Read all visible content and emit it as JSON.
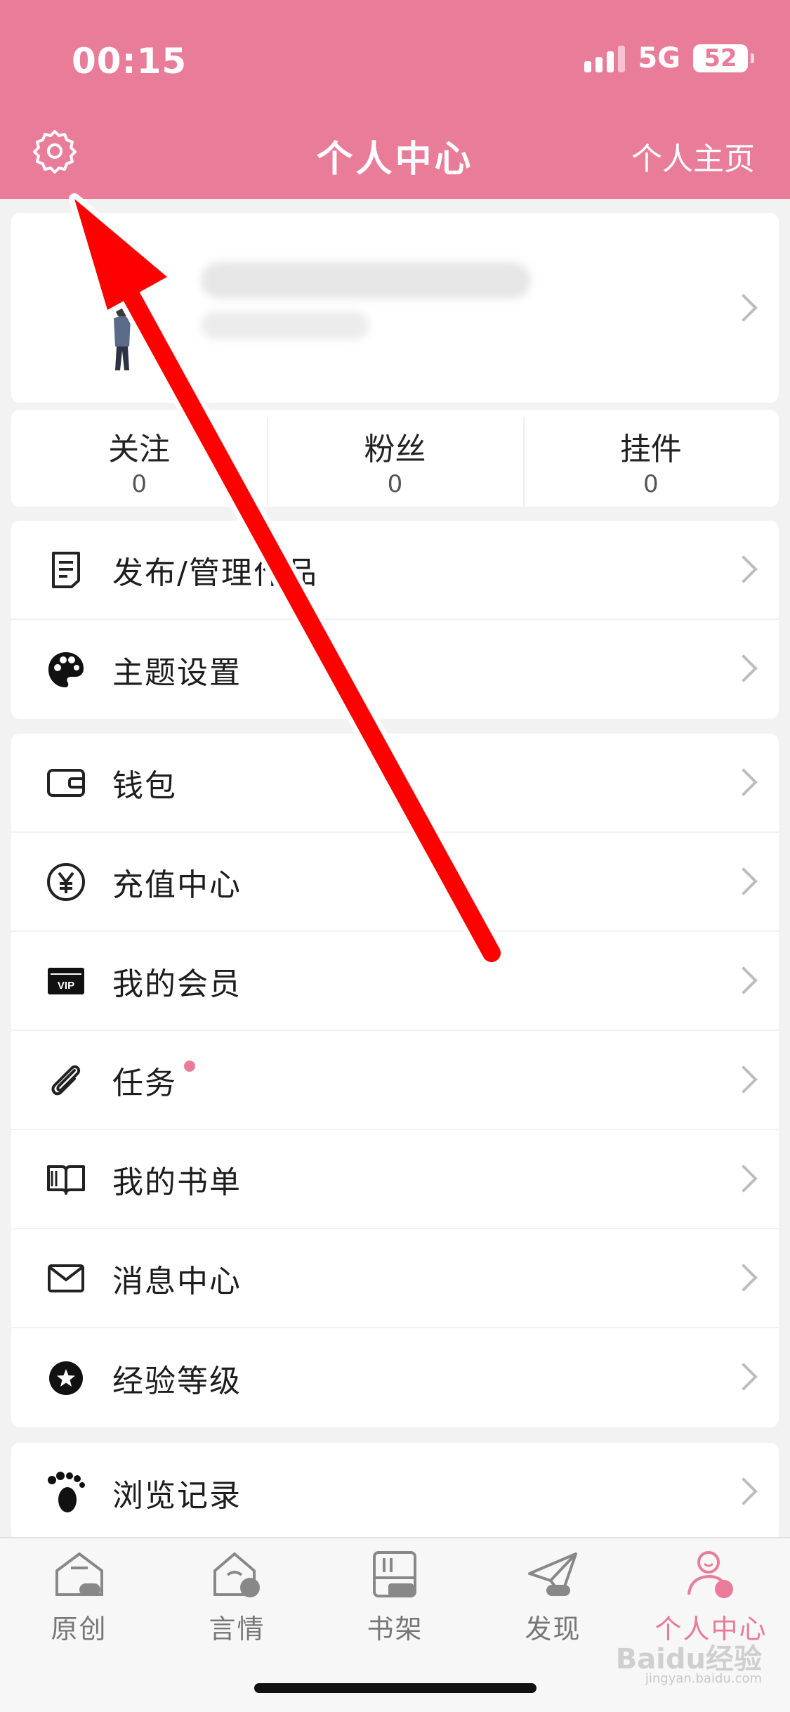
{
  "status_bar": {
    "time": "00:15",
    "network": "5G",
    "battery": "52"
  },
  "header": {
    "title": "个人中心",
    "home_link": "个人主页",
    "settings_icon": "gear-icon"
  },
  "stats": [
    {
      "label": "关注",
      "value": "0"
    },
    {
      "label": "粉丝",
      "value": "0"
    },
    {
      "label": "挂件",
      "value": "0"
    }
  ],
  "section1": [
    {
      "label": "发布/管理作品",
      "icon": "document-icon"
    },
    {
      "label": "主题设置",
      "icon": "palette-icon"
    }
  ],
  "section2": [
    {
      "label": "钱包",
      "icon": "wallet-icon"
    },
    {
      "label": "充值中心",
      "icon": "yen-icon"
    },
    {
      "label": "我的会员",
      "icon": "vip-icon",
      "vip_text": "VIP"
    },
    {
      "label": "任务",
      "icon": "paperclip-icon",
      "badge": "dot"
    },
    {
      "label": "我的书单",
      "icon": "book-icon"
    },
    {
      "label": "消息中心",
      "icon": "mail-icon"
    },
    {
      "label": "经验等级",
      "icon": "star-badge-icon"
    }
  ],
  "section3": [
    {
      "label": "浏览记录",
      "icon": "footprint-icon"
    }
  ],
  "bottom_nav": [
    {
      "label": "原创",
      "icon": "original-icon",
      "active": false
    },
    {
      "label": "言情",
      "icon": "romance-icon",
      "active": false
    },
    {
      "label": "书架",
      "icon": "bookshelf-icon",
      "active": false
    },
    {
      "label": "发现",
      "icon": "discover-icon",
      "active": false
    },
    {
      "label": "个人中心",
      "icon": "profile-icon",
      "active": true
    }
  ],
  "watermark": {
    "text": "Baidu经验",
    "sub": "jingyan.baidu.com"
  },
  "colors": {
    "accent": "#e97c99",
    "background": "#f2f2f2",
    "annotation_arrow": "#ff0000"
  }
}
